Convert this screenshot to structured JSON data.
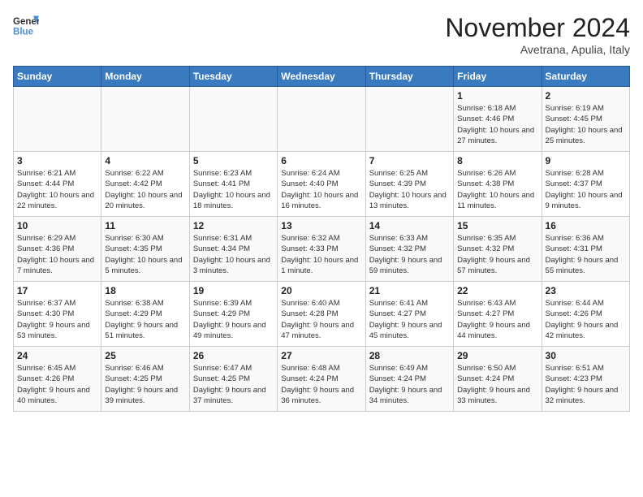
{
  "logo": {
    "general": "General",
    "blue": "Blue"
  },
  "title": "November 2024",
  "location": "Avetrana, Apulia, Italy",
  "days_of_week": [
    "Sunday",
    "Monday",
    "Tuesday",
    "Wednesday",
    "Thursday",
    "Friday",
    "Saturday"
  ],
  "weeks": [
    [
      {
        "day": "",
        "info": ""
      },
      {
        "day": "",
        "info": ""
      },
      {
        "day": "",
        "info": ""
      },
      {
        "day": "",
        "info": ""
      },
      {
        "day": "",
        "info": ""
      },
      {
        "day": "1",
        "info": "Sunrise: 6:18 AM\nSunset: 4:46 PM\nDaylight: 10 hours and 27 minutes."
      },
      {
        "day": "2",
        "info": "Sunrise: 6:19 AM\nSunset: 4:45 PM\nDaylight: 10 hours and 25 minutes."
      }
    ],
    [
      {
        "day": "3",
        "info": "Sunrise: 6:21 AM\nSunset: 4:44 PM\nDaylight: 10 hours and 22 minutes."
      },
      {
        "day": "4",
        "info": "Sunrise: 6:22 AM\nSunset: 4:42 PM\nDaylight: 10 hours and 20 minutes."
      },
      {
        "day": "5",
        "info": "Sunrise: 6:23 AM\nSunset: 4:41 PM\nDaylight: 10 hours and 18 minutes."
      },
      {
        "day": "6",
        "info": "Sunrise: 6:24 AM\nSunset: 4:40 PM\nDaylight: 10 hours and 16 minutes."
      },
      {
        "day": "7",
        "info": "Sunrise: 6:25 AM\nSunset: 4:39 PM\nDaylight: 10 hours and 13 minutes."
      },
      {
        "day": "8",
        "info": "Sunrise: 6:26 AM\nSunset: 4:38 PM\nDaylight: 10 hours and 11 minutes."
      },
      {
        "day": "9",
        "info": "Sunrise: 6:28 AM\nSunset: 4:37 PM\nDaylight: 10 hours and 9 minutes."
      }
    ],
    [
      {
        "day": "10",
        "info": "Sunrise: 6:29 AM\nSunset: 4:36 PM\nDaylight: 10 hours and 7 minutes."
      },
      {
        "day": "11",
        "info": "Sunrise: 6:30 AM\nSunset: 4:35 PM\nDaylight: 10 hours and 5 minutes."
      },
      {
        "day": "12",
        "info": "Sunrise: 6:31 AM\nSunset: 4:34 PM\nDaylight: 10 hours and 3 minutes."
      },
      {
        "day": "13",
        "info": "Sunrise: 6:32 AM\nSunset: 4:33 PM\nDaylight: 10 hours and 1 minute."
      },
      {
        "day": "14",
        "info": "Sunrise: 6:33 AM\nSunset: 4:32 PM\nDaylight: 9 hours and 59 minutes."
      },
      {
        "day": "15",
        "info": "Sunrise: 6:35 AM\nSunset: 4:32 PM\nDaylight: 9 hours and 57 minutes."
      },
      {
        "day": "16",
        "info": "Sunrise: 6:36 AM\nSunset: 4:31 PM\nDaylight: 9 hours and 55 minutes."
      }
    ],
    [
      {
        "day": "17",
        "info": "Sunrise: 6:37 AM\nSunset: 4:30 PM\nDaylight: 9 hours and 53 minutes."
      },
      {
        "day": "18",
        "info": "Sunrise: 6:38 AM\nSunset: 4:29 PM\nDaylight: 9 hours and 51 minutes."
      },
      {
        "day": "19",
        "info": "Sunrise: 6:39 AM\nSunset: 4:29 PM\nDaylight: 9 hours and 49 minutes."
      },
      {
        "day": "20",
        "info": "Sunrise: 6:40 AM\nSunset: 4:28 PM\nDaylight: 9 hours and 47 minutes."
      },
      {
        "day": "21",
        "info": "Sunrise: 6:41 AM\nSunset: 4:27 PM\nDaylight: 9 hours and 45 minutes."
      },
      {
        "day": "22",
        "info": "Sunrise: 6:43 AM\nSunset: 4:27 PM\nDaylight: 9 hours and 44 minutes."
      },
      {
        "day": "23",
        "info": "Sunrise: 6:44 AM\nSunset: 4:26 PM\nDaylight: 9 hours and 42 minutes."
      }
    ],
    [
      {
        "day": "24",
        "info": "Sunrise: 6:45 AM\nSunset: 4:26 PM\nDaylight: 9 hours and 40 minutes."
      },
      {
        "day": "25",
        "info": "Sunrise: 6:46 AM\nSunset: 4:25 PM\nDaylight: 9 hours and 39 minutes."
      },
      {
        "day": "26",
        "info": "Sunrise: 6:47 AM\nSunset: 4:25 PM\nDaylight: 9 hours and 37 minutes."
      },
      {
        "day": "27",
        "info": "Sunrise: 6:48 AM\nSunset: 4:24 PM\nDaylight: 9 hours and 36 minutes."
      },
      {
        "day": "28",
        "info": "Sunrise: 6:49 AM\nSunset: 4:24 PM\nDaylight: 9 hours and 34 minutes."
      },
      {
        "day": "29",
        "info": "Sunrise: 6:50 AM\nSunset: 4:24 PM\nDaylight: 9 hours and 33 minutes."
      },
      {
        "day": "30",
        "info": "Sunrise: 6:51 AM\nSunset: 4:23 PM\nDaylight: 9 hours and 32 minutes."
      }
    ]
  ]
}
